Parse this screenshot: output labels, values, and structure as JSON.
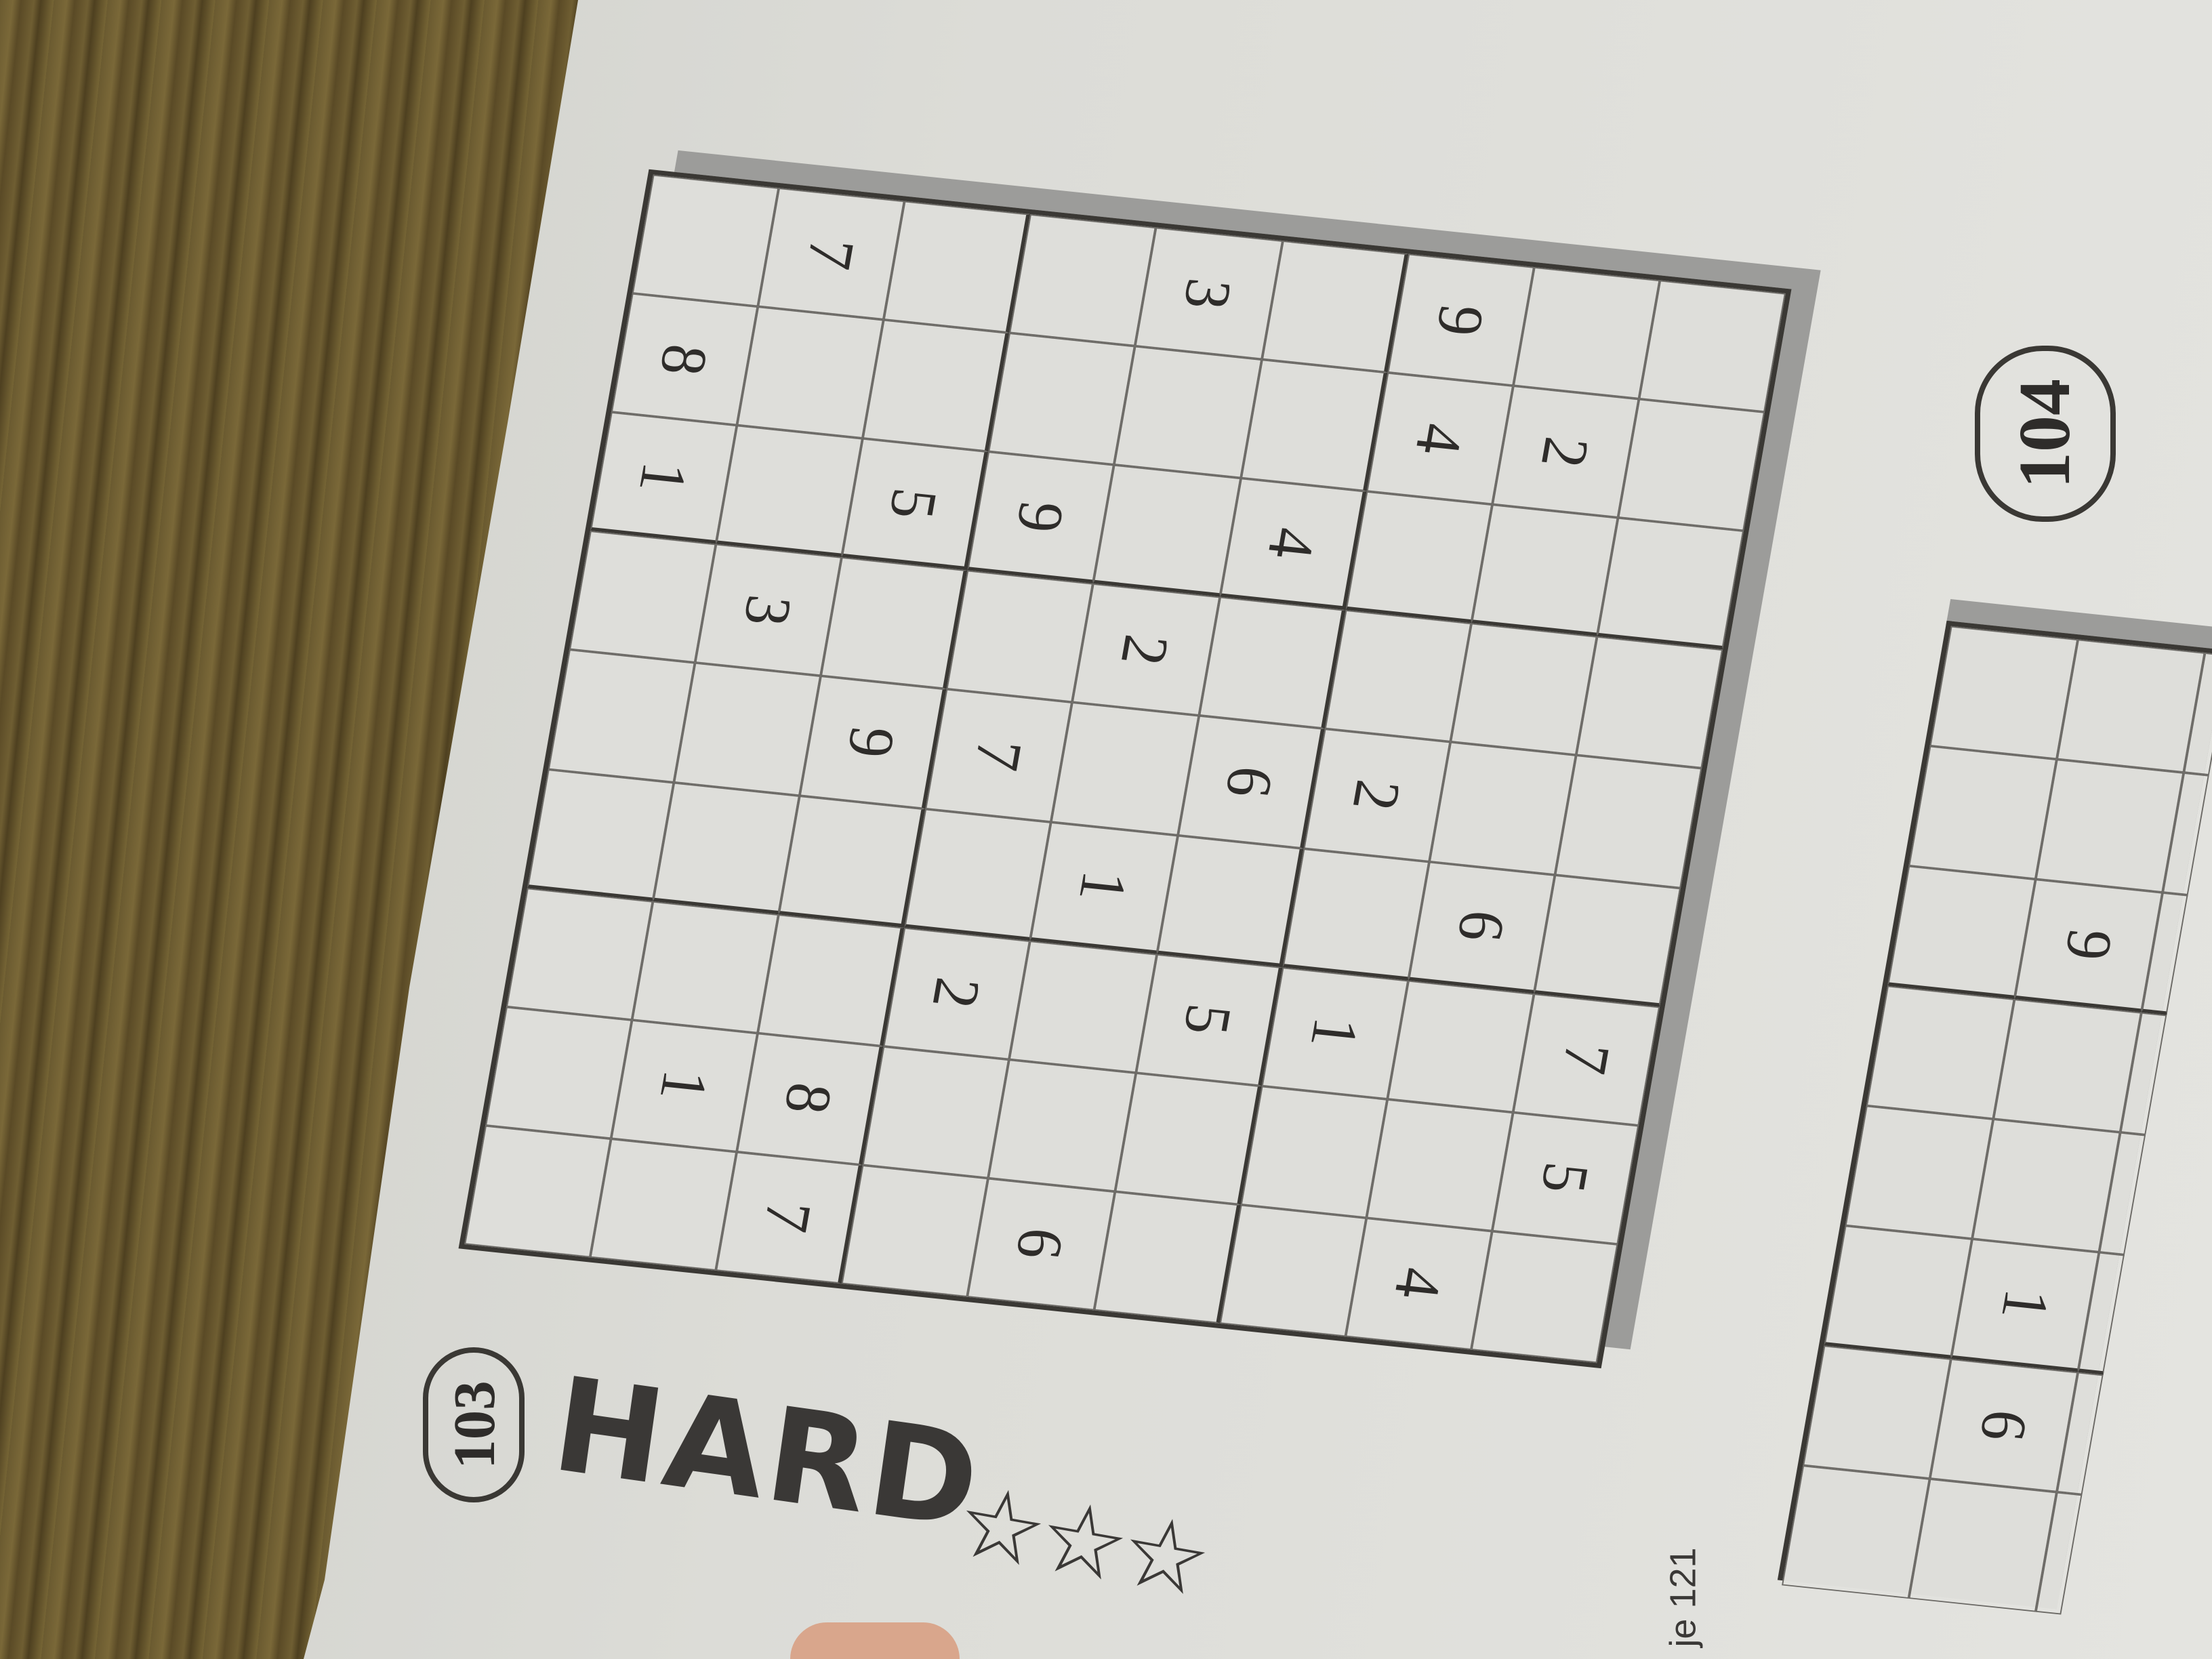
{
  "puzzle_103": {
    "number": "103",
    "difficulty": "HARD",
    "stars": "☆☆☆",
    "rating": 3,
    "grid": [
      [
        "",
        "7",
        "",
        "",
        "3",
        "",
        "9",
        "",
        ""
      ],
      [
        "8",
        "",
        "",
        "",
        "",
        "",
        "4",
        "2",
        ""
      ],
      [
        "1",
        "",
        "5",
        "9",
        "",
        "4",
        "",
        "",
        ""
      ],
      [
        "",
        "3",
        "",
        "",
        "2",
        "",
        "",
        "",
        ""
      ],
      [
        "",
        "",
        "9",
        "7",
        "",
        "6",
        "2",
        "",
        ""
      ],
      [
        "",
        "",
        "",
        "",
        "1",
        "",
        "",
        "6",
        ""
      ],
      [
        "",
        "",
        "",
        "2",
        "",
        "5",
        "1",
        "",
        "7"
      ],
      [
        "",
        "1",
        "8",
        "",
        "",
        "",
        "",
        "",
        "5"
      ],
      [
        "",
        "",
        "7",
        "",
        "6",
        "",
        "",
        "4",
        ""
      ]
    ]
  },
  "puzzle_104": {
    "number": "104",
    "grid": [
      [
        "",
        "",
        ""
      ],
      [
        "",
        "",
        ""
      ],
      [
        "",
        "9",
        ""
      ],
      [
        "",
        "",
        ""
      ],
      [
        "",
        "",
        ""
      ],
      [
        "",
        "1",
        ""
      ],
      [
        "",
        "6",
        ""
      ],
      [
        "",
        "",
        ""
      ],
      [
        "",
        "",
        ""
      ]
    ]
  },
  "page_ref": "je 121"
}
